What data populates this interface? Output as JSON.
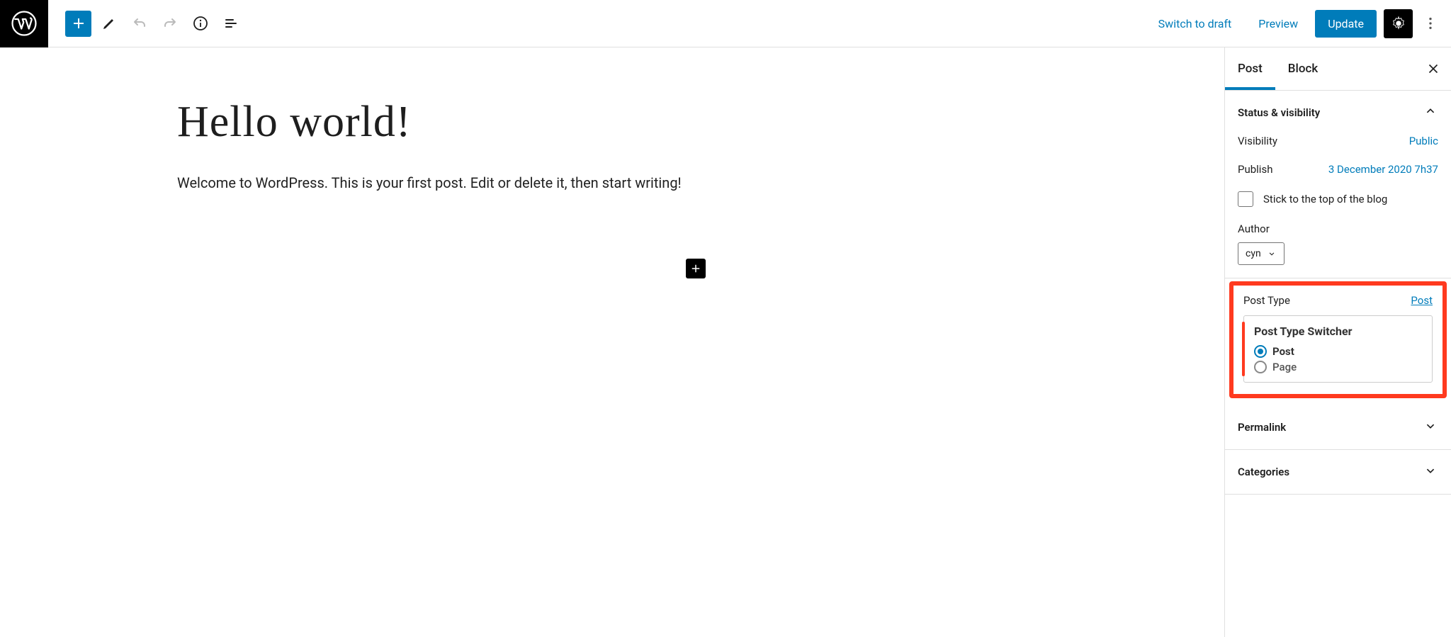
{
  "topbar": {
    "switch_to_draft": "Switch to draft",
    "preview": "Preview",
    "update": "Update"
  },
  "editor": {
    "title": "Hello world!",
    "body": "Welcome to WordPress. This is your first post. Edit or delete it, then start writing!"
  },
  "sidebar": {
    "tabs": {
      "post": "Post",
      "block": "Block"
    },
    "status_panel": {
      "title": "Status & visibility",
      "visibility_label": "Visibility",
      "visibility_value": "Public",
      "publish_label": "Publish",
      "publish_value": "3 December 2020 7h37",
      "sticky_label": "Stick to the top of the blog",
      "author_label": "Author",
      "author_value": "cyn"
    },
    "post_type_panel": {
      "title": "Post Type",
      "link": "Post",
      "switcher_title": "Post Type Switcher",
      "option_post": "Post",
      "option_page": "Page"
    },
    "permalink_title": "Permalink",
    "categories_title": "Categories"
  }
}
